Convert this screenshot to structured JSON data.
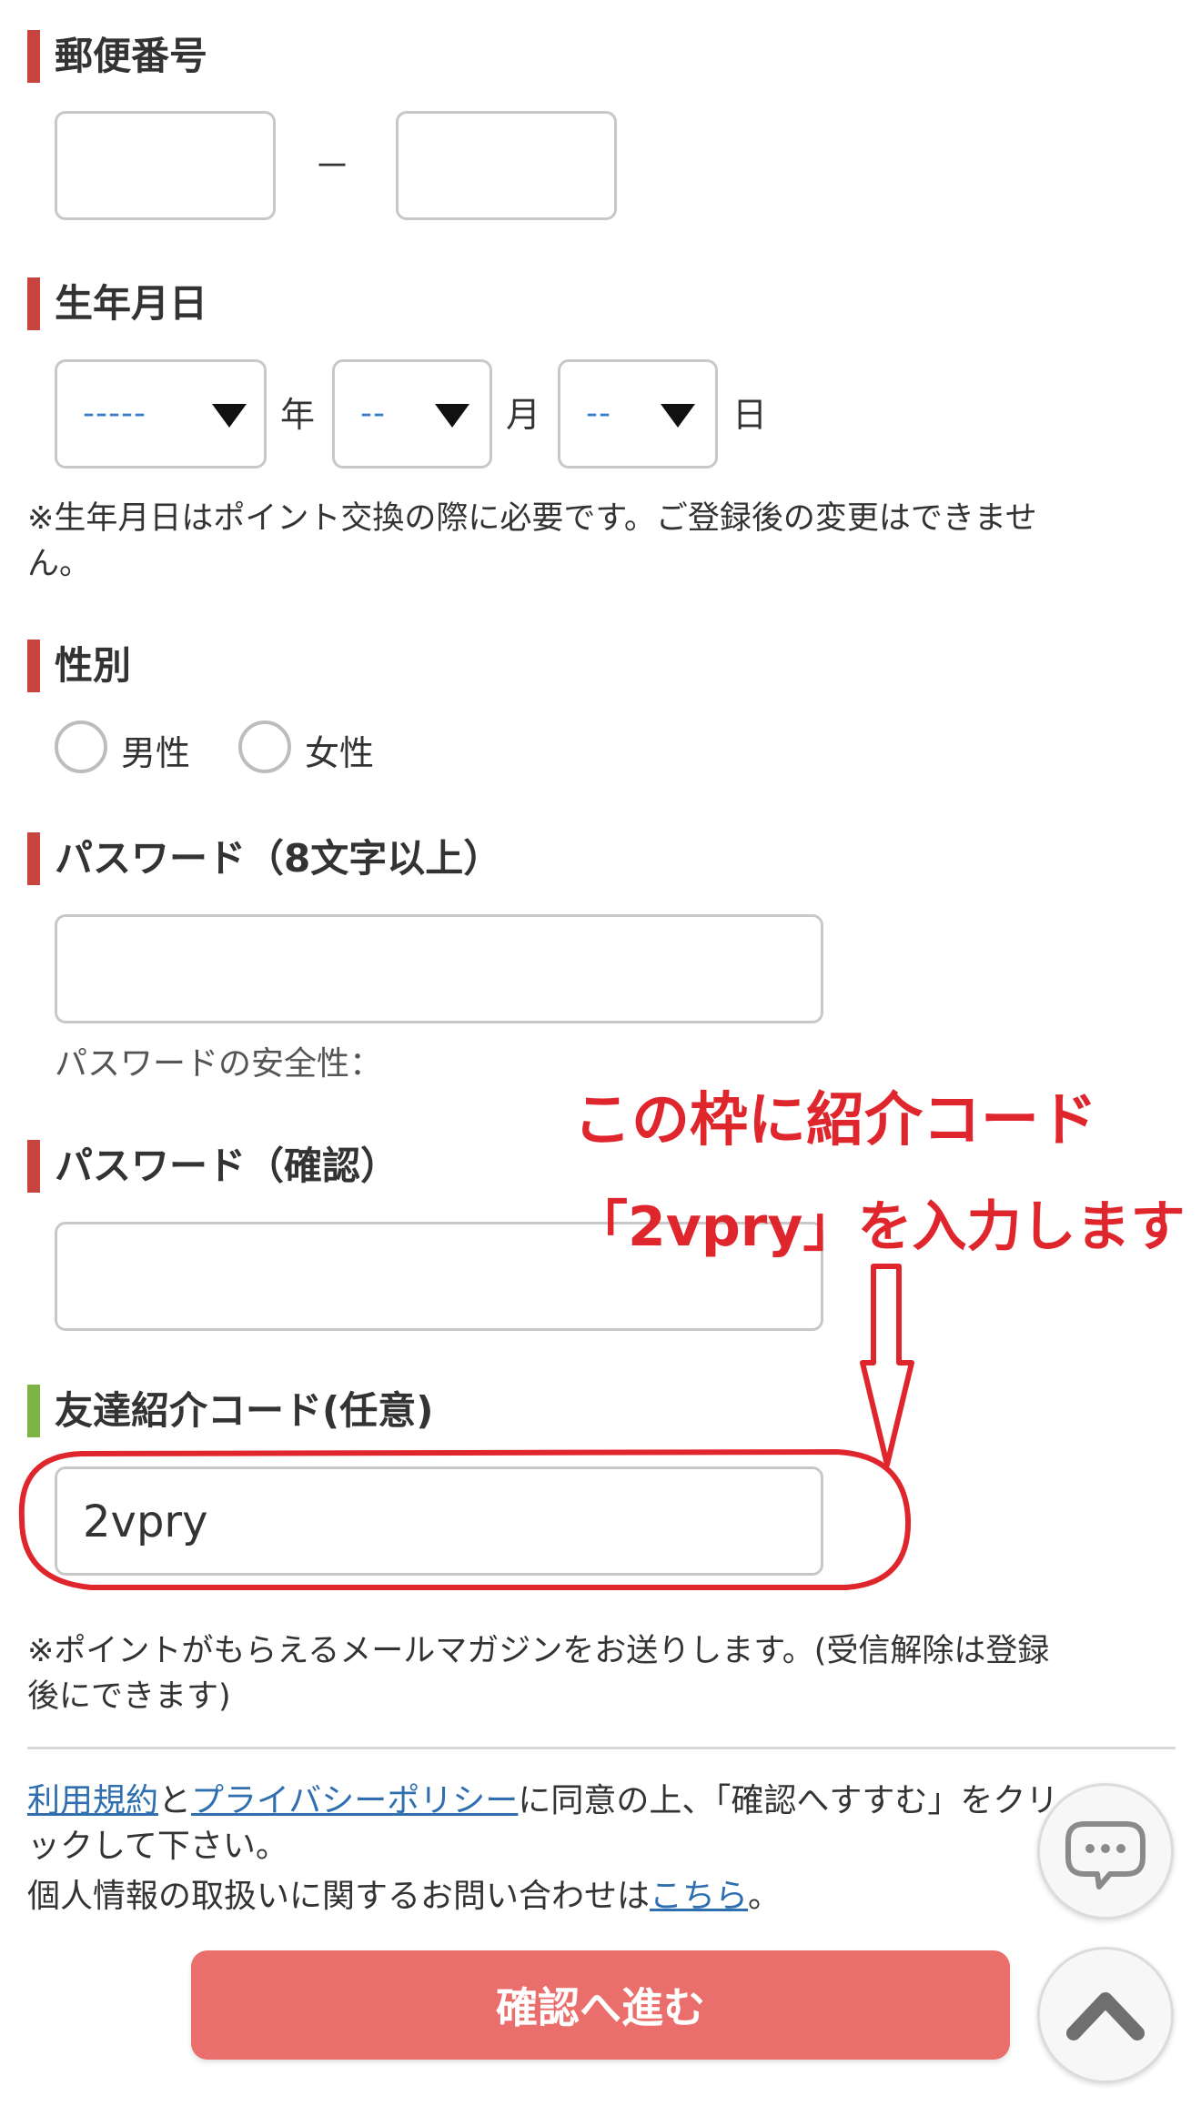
{
  "postal": {
    "label": "郵便番号",
    "separator": "－"
  },
  "birthday": {
    "label": "生年月日",
    "year_value": "-----",
    "year_unit": "年",
    "month_value": "--",
    "month_unit": "月",
    "day_value": "--",
    "day_unit": "日",
    "note_line1": "※生年月日はポイント交換の際に必要です。ご登録後の変更はできませ",
    "note_line2": "ん。"
  },
  "gender": {
    "label": "性別",
    "options": [
      "男性",
      "女性"
    ]
  },
  "password": {
    "label": "パスワード（8文字以上）",
    "strength_label": "パスワードの安全性："
  },
  "password_confirm": {
    "label": "パスワード（確認）"
  },
  "referral": {
    "label": "友達紹介コード(任意)",
    "value": "2vpry"
  },
  "annotation": {
    "line1": "この枠に紹介コード",
    "line2": "「2vpry」を入力します",
    "color": "#e0262d"
  },
  "mail_note": {
    "line1": "※ポイントがもらえるメールマガジンをお送りします。(受信解除は登録",
    "line2": "後にできます)"
  },
  "terms": {
    "link_terms": "利用規約",
    "and": "と",
    "link_privacy": "プライバシーポリシー",
    "text_rest1": "に同意の上、「確認へすすむ」をクリ",
    "text_line2": "ックして下さい。",
    "inquiry_text": "個人情報の取扱いに関するお問い合わせは",
    "inquiry_link": "こちら",
    "inquiry_end": "。"
  },
  "submit_button": {
    "label": "確認へ進む",
    "color": "#ea6f6c"
  },
  "floating": {
    "chat_icon": "chat-bubble-icon",
    "top_icon": "chevron-up-icon"
  }
}
